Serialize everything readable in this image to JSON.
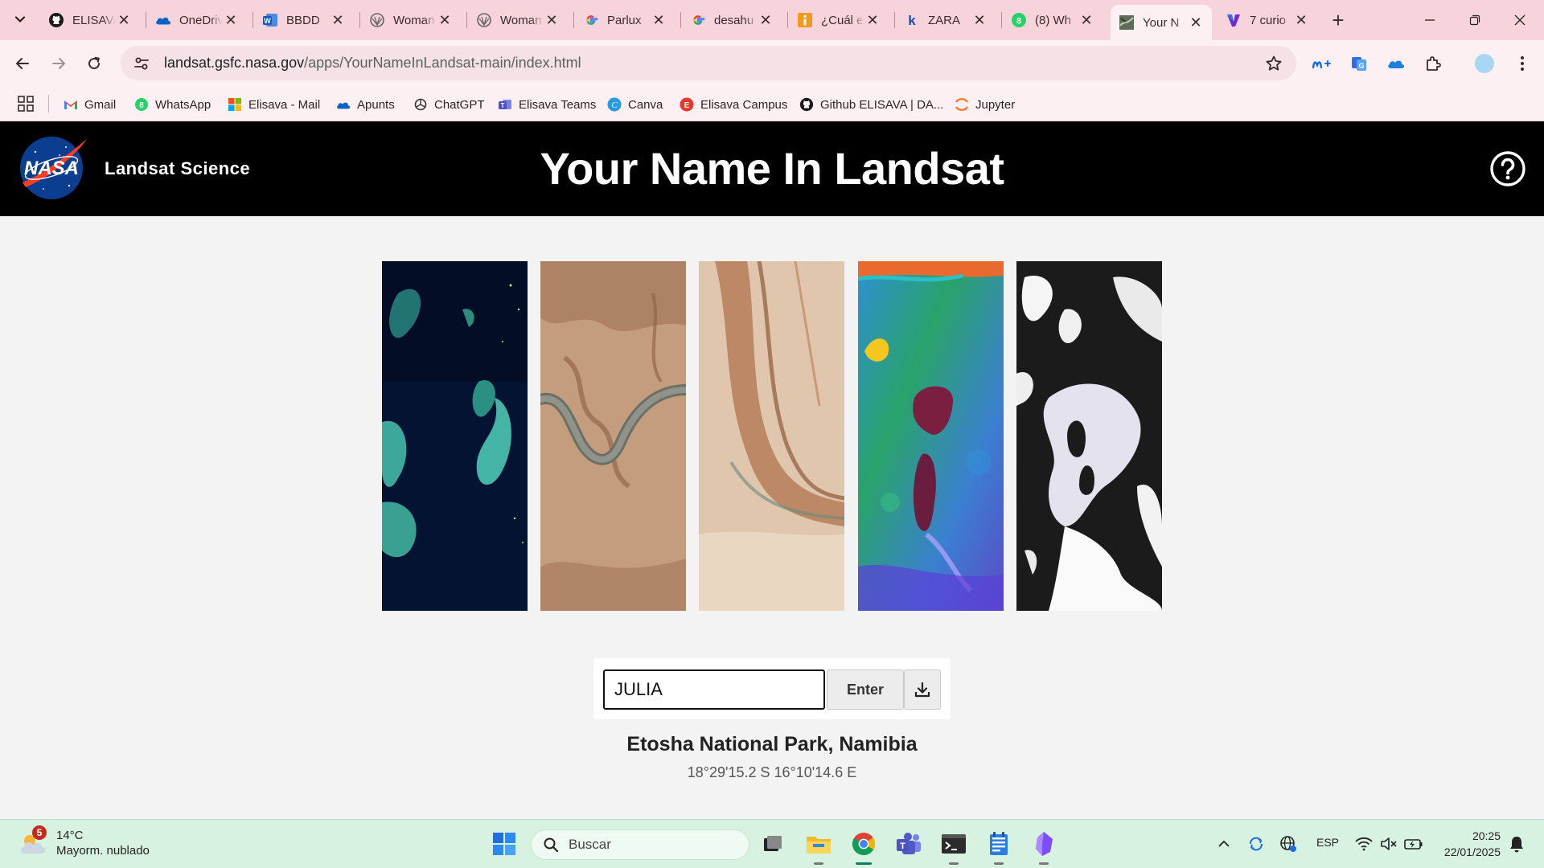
{
  "browser": {
    "tabs": [
      {
        "title": "ELISAVA",
        "icon": "github-icon"
      },
      {
        "title": "OneDrive",
        "icon": "onedrive-icon"
      },
      {
        "title": "BBDD",
        "icon": "word-icon"
      },
      {
        "title": "Woman",
        "icon": "site-icon"
      },
      {
        "title": "Woman",
        "icon": "site-icon"
      },
      {
        "title": "Parlux",
        "icon": "google-icon"
      },
      {
        "title": "desahu",
        "icon": "google-icon"
      },
      {
        "title": "¿Cuál es",
        "icon": "site-icon"
      },
      {
        "title": "ZARA",
        "icon": "k-icon"
      },
      {
        "title": "(8) Wh",
        "icon": "whatsapp-icon"
      },
      {
        "title": "Your N",
        "icon": "landsat-icon",
        "active": true
      },
      {
        "title": "7 curio",
        "icon": "site-icon"
      }
    ],
    "address": {
      "host": "landsat.gsfc.nasa.gov",
      "path": "/apps/YourNameInLandsat-main/index.html"
    },
    "bookmarks": [
      {
        "label": "Gmail",
        "icon": "gmail-icon"
      },
      {
        "label": "WhatsApp",
        "icon": "whatsapp-icon"
      },
      {
        "label": "Elisava - Mail",
        "icon": "microsoft-icon"
      },
      {
        "label": "Apunts",
        "icon": "onedrive-icon"
      },
      {
        "label": "ChatGPT",
        "icon": "chatgpt-icon"
      },
      {
        "label": "Elisava Teams",
        "icon": "teams-icon"
      },
      {
        "label": "Canva",
        "icon": "canva-icon"
      },
      {
        "label": "Elisava Campus",
        "icon": "campus-icon"
      },
      {
        "label": "Github ELISAVA | DA...",
        "icon": "github-icon"
      },
      {
        "label": "Jupyter",
        "icon": "jupyter-icon"
      }
    ]
  },
  "site": {
    "logo": "NASA",
    "brand": "Landsat Science",
    "title": "Your Name In Landsat"
  },
  "letters": [
    {
      "letter": "J"
    },
    {
      "letter": "U"
    },
    {
      "letter": "L"
    },
    {
      "letter": "I"
    },
    {
      "letter": "A"
    }
  ],
  "form": {
    "name_value": "JULIA",
    "enter_label": "Enter"
  },
  "location": {
    "name": "Etosha National Park, Namibia",
    "coords": "18°29'15.2 S 16°10'14.6 E"
  },
  "taskbar": {
    "weather_badge": "5",
    "weather_temp": "14°C",
    "weather_desc": "Mayorm. nublado",
    "search_placeholder": "Buscar",
    "lang": "ESP",
    "time": "20:25",
    "date": "22/01/2025"
  },
  "colors": {
    "tabstrip": "#f7d3dc",
    "toolbar": "#fdf0f2",
    "header": "#000000",
    "page_bg": "#f3f3f3",
    "taskbar": "#d7f2e0"
  }
}
